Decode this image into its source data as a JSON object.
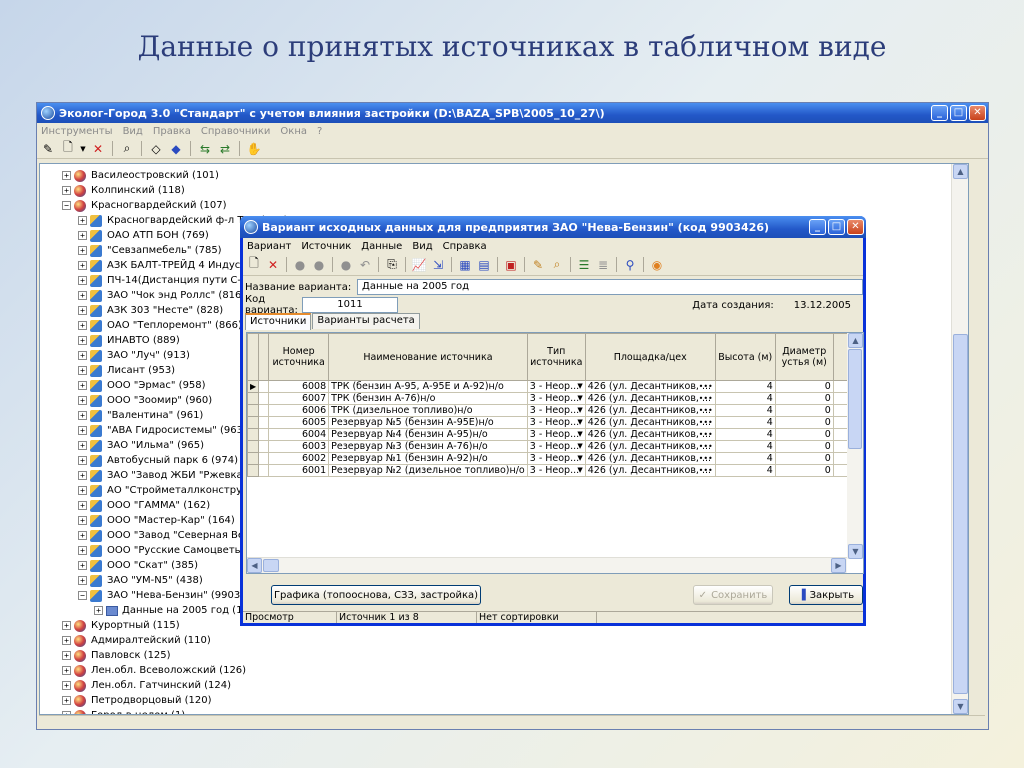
{
  "slide": {
    "title": "Данные о принятых источниках в табличном виде"
  },
  "app": {
    "title": "Эколог-Город 3.0 \"Стандарт\" с учетом влияния застройки (D:\\BAZA_SPB\\2005_10_27\\)",
    "menu": [
      "Инструменты",
      "Вид",
      "Правка",
      "Справочники",
      "Окна",
      "?"
    ],
    "window_buttons": {
      "minimize": "_",
      "maximize": "□",
      "close": "✕"
    },
    "toolbar_icons": [
      "edit-icon",
      "new-document-icon",
      "dropdown-arrow-icon",
      "delete-icon",
      "find-icon",
      "link-icon",
      "unlink-icon",
      "copy-left-icon",
      "copy-right-icon",
      "hand-icon"
    ],
    "tree": [
      {
        "label": "Василеостровский (101)",
        "level": 0,
        "expander": "+",
        "icon": "district"
      },
      {
        "label": "Колпинский (118)",
        "level": 0,
        "expander": "+",
        "icon": "district"
      },
      {
        "label": "Красногвардейский (107)",
        "level": 0,
        "expander": "−",
        "icon": "district"
      },
      {
        "label": "Красногвардейский ф-л ТЭК (112)",
        "level": 1,
        "expander": "+",
        "icon": "enterprise"
      },
      {
        "label": "ОАО АТП БОН (769)",
        "level": 1,
        "expander": "+",
        "icon": "enterprise"
      },
      {
        "label": "\"Севзапмебель\" (785)",
        "level": 1,
        "expander": "+",
        "icon": "enterprise"
      },
      {
        "label": "АЗК БАЛТ-ТРЕЙД 4 Индустр. (794)",
        "level": 1,
        "expander": "+",
        "icon": "enterprise"
      },
      {
        "label": "ПЧ-14(Дистанция пути С-Пб) (807)",
        "level": 1,
        "expander": "+",
        "icon": "enterprise"
      },
      {
        "label": "ЗАО \"Чок энд Роллс\" (816)",
        "level": 1,
        "expander": "+",
        "icon": "enterprise"
      },
      {
        "label": "АЗК 303 \"Несте\" (828)",
        "level": 1,
        "expander": "+",
        "icon": "enterprise"
      },
      {
        "label": "ОАО \"Теплоремонт\" (866)",
        "level": 1,
        "expander": "+",
        "icon": "enterprise"
      },
      {
        "label": "ИНАВТО (889)",
        "level": 1,
        "expander": "+",
        "icon": "enterprise"
      },
      {
        "label": "ЗАО \"Луч\" (913)",
        "level": 1,
        "expander": "+",
        "icon": "enterprise"
      },
      {
        "label": "Лисант (953)",
        "level": 1,
        "expander": "+",
        "icon": "enterprise"
      },
      {
        "label": "ООО \"Эрмас\" (958)",
        "level": 1,
        "expander": "+",
        "icon": "enterprise"
      },
      {
        "label": "ООО \"Зоомир\" (960)",
        "level": 1,
        "expander": "+",
        "icon": "enterprise"
      },
      {
        "label": "\"Валентина\" (961)",
        "level": 1,
        "expander": "+",
        "icon": "enterprise"
      },
      {
        "label": "\"АВА Гидросистемы\" (963)",
        "level": 1,
        "expander": "+",
        "icon": "enterprise"
      },
      {
        "label": "ЗАО \"Ильма\" (965)",
        "level": 1,
        "expander": "+",
        "icon": "enterprise"
      },
      {
        "label": "Автобусный парк 6 (974)",
        "level": 1,
        "expander": "+",
        "icon": "enterprise"
      },
      {
        "label": "ЗАО \"Завод ЖБИ \"Ржевка\" (990)",
        "level": 1,
        "expander": "+",
        "icon": "enterprise"
      },
      {
        "label": "АО \"Стройметаллконструкция\" (99",
        "level": 1,
        "expander": "+",
        "icon": "enterprise"
      },
      {
        "label": "ООО \"ГАММА\" (162)",
        "level": 1,
        "expander": "+",
        "icon": "enterprise"
      },
      {
        "label": "ООО \"Мастер-Кар\" (164)",
        "level": 1,
        "expander": "+",
        "icon": "enterprise"
      },
      {
        "label": "ООО \"Завод \"Северная Верфь\" (",
        "level": 1,
        "expander": "+",
        "icon": "enterprise"
      },
      {
        "label": "ООО \"Русские Самоцветы\" (...",
        "level": 1,
        "expander": "+",
        "icon": "enterprise"
      },
      {
        "label": "ООО \"Скат\" (385)",
        "level": 1,
        "expander": "+",
        "icon": "enterprise"
      },
      {
        "label": "ЗАО \"УМ-N5\" (438)",
        "level": 1,
        "expander": "+",
        "icon": "enterprise"
      },
      {
        "label": "ЗАО \"Нева-Бензин\" (9903426)",
        "level": 1,
        "expander": "−",
        "icon": "enterprise"
      },
      {
        "label": "Данные на 2005 год (1011)",
        "level": 2,
        "expander": "+",
        "icon": "variant"
      },
      {
        "label": "Курортный (115)",
        "level": 0,
        "expander": "+",
        "icon": "district"
      },
      {
        "label": "Адмиралтейский (110)",
        "level": 0,
        "expander": "+",
        "icon": "district"
      },
      {
        "label": "Павловск (125)",
        "level": 0,
        "expander": "+",
        "icon": "district"
      },
      {
        "label": "Лен.обл. Всеволожский (126)",
        "level": 0,
        "expander": "+",
        "icon": "district"
      },
      {
        "label": "Лен.обл. Гатчинский (124)",
        "level": 0,
        "expander": "+",
        "icon": "district"
      },
      {
        "label": "Петродворцовый (120)",
        "level": 0,
        "expander": "+",
        "icon": "district"
      },
      {
        "label": "Город в целом (1)",
        "level": 0,
        "expander": "+",
        "icon": "district"
      }
    ]
  },
  "dialog": {
    "title": "Вариант исходных данных для предприятия ЗАО \"Нева-Бензин\" (код 9903426)",
    "menu": [
      "Вариант",
      "Источник",
      "Данные",
      "Вид",
      "Справка"
    ],
    "toolbar_icons": [
      "new-icon",
      "delete-icon",
      "circle-icon",
      "circle-icon",
      "circle-icon",
      "undo-icon",
      "copy-icon",
      "chart-icon",
      "export-icon",
      "grid-icon",
      "table-icon",
      "map-icon",
      "edit-icon",
      "find-icon",
      "list-icon",
      "stack-icon",
      "search-icon",
      "run-icon"
    ],
    "variant_name_label": "Название варианта:",
    "variant_name": "Данные на 2005 год",
    "variant_code_label": "Код варианта:",
    "variant_code": "1011",
    "created_label": "Дата создания:",
    "created_date": "13.12.2005",
    "tabs": [
      "Источники",
      "Варианты расчета"
    ],
    "columns": [
      "Номер источника",
      "Наименование источника",
      "Тип источника",
      "Площадка/цех",
      "Высота (м)",
      "Диаметр устья (м)"
    ],
    "rows": [
      {
        "num": "6008",
        "name": "ТРК (бензин А-95, А-95Е и А-92)н/о",
        "type": "3 - Неор...",
        "site": "426 (ул. Десантников, ...",
        "height": "4",
        "diam": "0",
        "selected": true
      },
      {
        "num": "6007",
        "name": "ТРК (бензин А-76)н/о",
        "type": "3 - Неор...",
        "site": "426 (ул. Десантников, ...",
        "height": "4",
        "diam": "0"
      },
      {
        "num": "6006",
        "name": "ТРК (дизельное топливо)н/о",
        "type": "3 - Неор...",
        "site": "426 (ул. Десантников, ...",
        "height": "4",
        "diam": "0"
      },
      {
        "num": "6005",
        "name": "Резервуар №5 (бензин А-95Е)н/о",
        "type": "3 - Неор...",
        "site": "426 (ул. Десантников, ...",
        "height": "4",
        "diam": "0"
      },
      {
        "num": "6004",
        "name": "Резервуар №4 (бензин А-95)н/о",
        "type": "3 - Неор...",
        "site": "426 (ул. Десантников, ...",
        "height": "4",
        "diam": "0"
      },
      {
        "num": "6003",
        "name": "Резервуар №3 (бензин А-76)н/о",
        "type": "3 - Неор...",
        "site": "426 (ул. Десантников, ...",
        "height": "4",
        "diam": "0"
      },
      {
        "num": "6002",
        "name": "Резервуар №1 (бензин А-92)н/о",
        "type": "3 - Неор...",
        "site": "426 (ул. Десантников, ...",
        "height": "4",
        "diam": "0"
      },
      {
        "num": "6001",
        "name": "Резервуар №2 (дизельное топливо)н/о",
        "type": "3 - Неор...",
        "site": "426 (ул. Десантников, ...",
        "height": "4",
        "diam": "0"
      }
    ],
    "graphics_button": "Графика (топооснова, СЗЗ, застройка)",
    "save_button": "Сохранить",
    "close_button": "Закрыть",
    "status": {
      "mode": "Просмотр",
      "position": "Источник 1 из 8",
      "sort": "Нет сортировки"
    }
  }
}
